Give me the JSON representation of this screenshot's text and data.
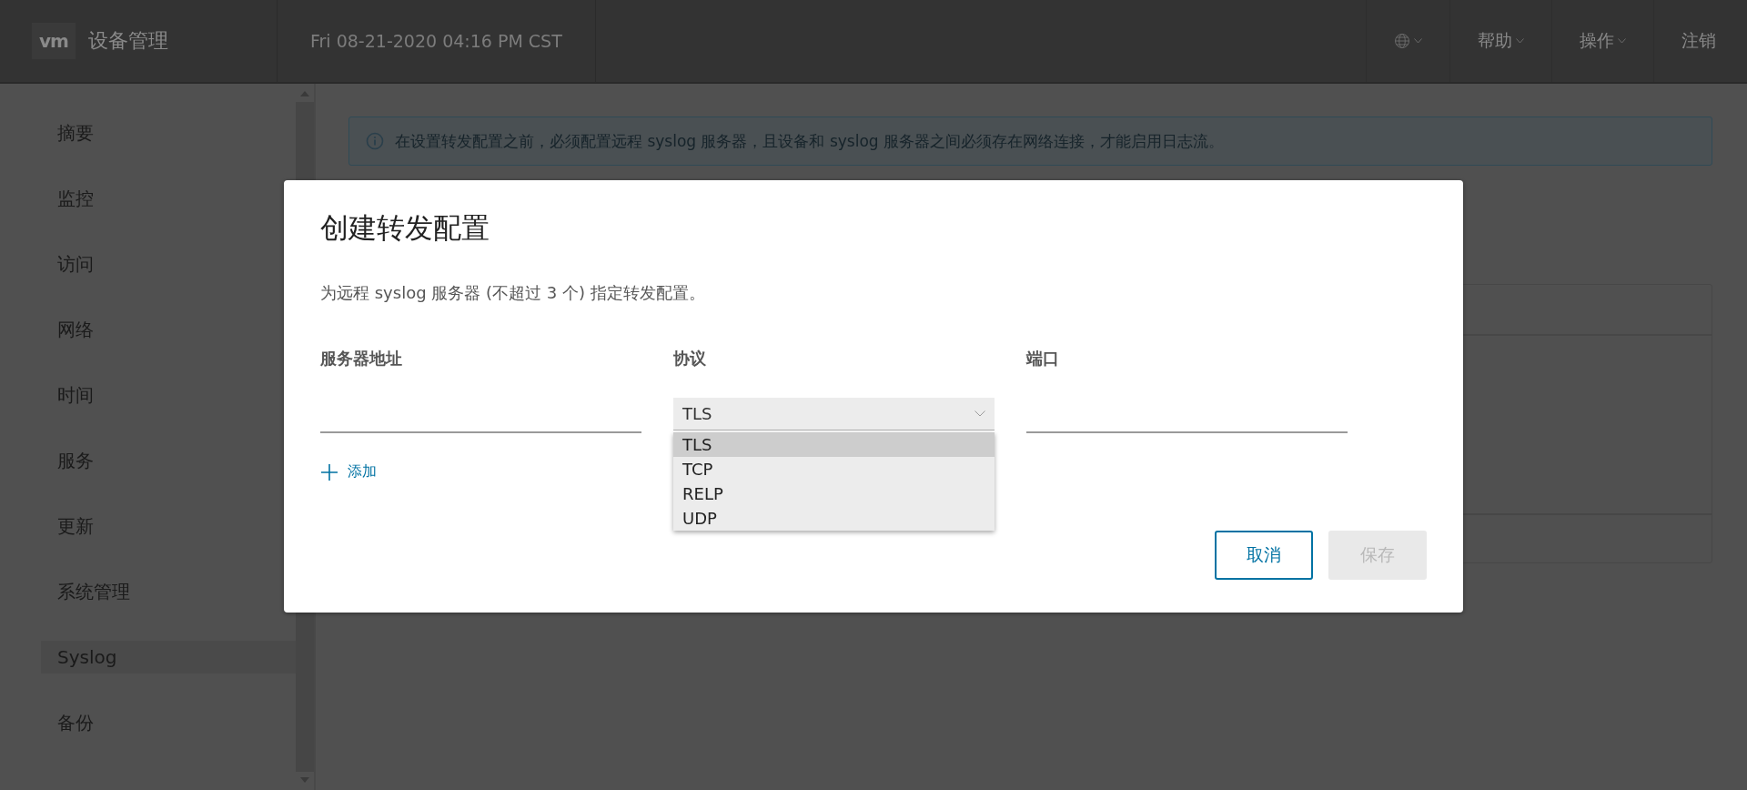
{
  "header": {
    "logo": "vm",
    "title": "设备管理",
    "datetime": "Fri 08-21-2020 04:16 PM CST",
    "menu": [
      {
        "label": "帮助",
        "kind": "dropdown"
      },
      {
        "label": "操作",
        "kind": "dropdown"
      },
      {
        "label": "注销",
        "kind": "link"
      }
    ]
  },
  "sidebar": {
    "items": [
      {
        "label": "摘要",
        "selected": false
      },
      {
        "label": "监控",
        "selected": false
      },
      {
        "label": "访问",
        "selected": false
      },
      {
        "label": "网络",
        "selected": false
      },
      {
        "label": "时间",
        "selected": false
      },
      {
        "label": "服务",
        "selected": false
      },
      {
        "label": "更新",
        "selected": false
      },
      {
        "label": "系统管理",
        "selected": false
      },
      {
        "label": "Syslog",
        "selected": true
      },
      {
        "label": "备份",
        "selected": false
      }
    ]
  },
  "info_banner": {
    "text": "在设置转发配置之前，必须配置远程 syslog 服务器，且设备和 syslog 服务器之间必须存在网络连接，才能启用日志流。"
  },
  "modal": {
    "title": "创建转发配置",
    "description": "为远程 syslog 服务器 (不超过 3 个) 指定转发配置。",
    "fields": [
      {
        "label": "服务器地址",
        "kind": "text"
      },
      {
        "label": "协议",
        "kind": "select",
        "value": "TLS",
        "expanded": true,
        "options": [
          {
            "label": "TLS",
            "selected": true
          },
          {
            "label": "TCP",
            "selected": false
          },
          {
            "label": "RELP",
            "selected": false
          },
          {
            "label": "UDP",
            "selected": false
          }
        ]
      },
      {
        "label": "端口",
        "kind": "text"
      }
    ],
    "add_link": "添加",
    "buttons": [
      {
        "label": "取消",
        "disabled": false
      },
      {
        "label": "保存",
        "disabled": true
      }
    ]
  }
}
